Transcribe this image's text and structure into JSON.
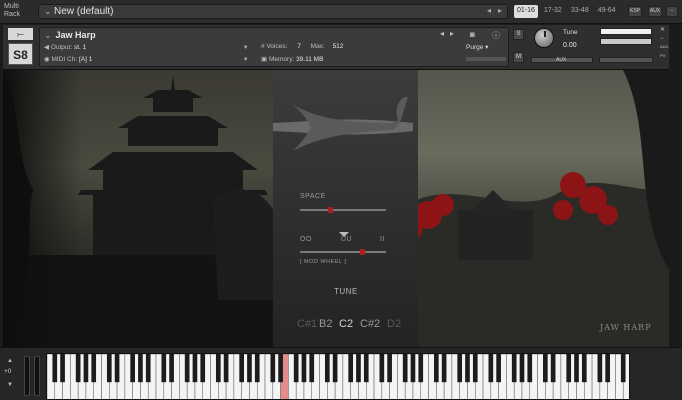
{
  "topbar": {
    "multi_rack_line1": "Multi",
    "multi_rack_line2": "Rack",
    "rack_title": "New (default)",
    "pages": [
      "01-16",
      "17-32",
      "33-48",
      "49-64"
    ],
    "active_page": "01-16",
    "buttons": {
      "ksp": "KSP",
      "aux": "AUX"
    }
  },
  "instrument": {
    "logo_top": "⤚",
    "logo_bottom": "S8",
    "name": "Jaw Harp",
    "output_label": "Output:",
    "output_value": "st. 1",
    "voices_label": "Voices:",
    "voices_value": "7",
    "max_label": "Max:",
    "max_value": "512",
    "midi_label": "MIDI Ch:",
    "midi_value": "[A]  1",
    "memory_label": "Memory:",
    "memory_value": "39.11 MB",
    "purge_label": "Purge",
    "solo": "S",
    "mute": "M",
    "tune_label": "Tune",
    "tune_value": "0.00",
    "aux_label": "AUX",
    "pv_label": "PV",
    "colors": {
      "accent": "#b31c1c"
    }
  },
  "artwork": {
    "space_label": "SPACE",
    "space_level": 0.35,
    "vowel_labels": [
      "OO",
      "UU",
      "II"
    ],
    "vowel_level": 0.72,
    "modwheel_label": "[ MOD WHEEL ]",
    "tune_header": "TUNE",
    "notes": [
      "C#1",
      "B2",
      "C2",
      "C#2",
      "D2"
    ],
    "current_note": "C2",
    "brand_text": "JAW HARP"
  },
  "keyboard": {
    "octave_label": "+0",
    "white_keys": 75,
    "pressed_key_index": 30
  }
}
